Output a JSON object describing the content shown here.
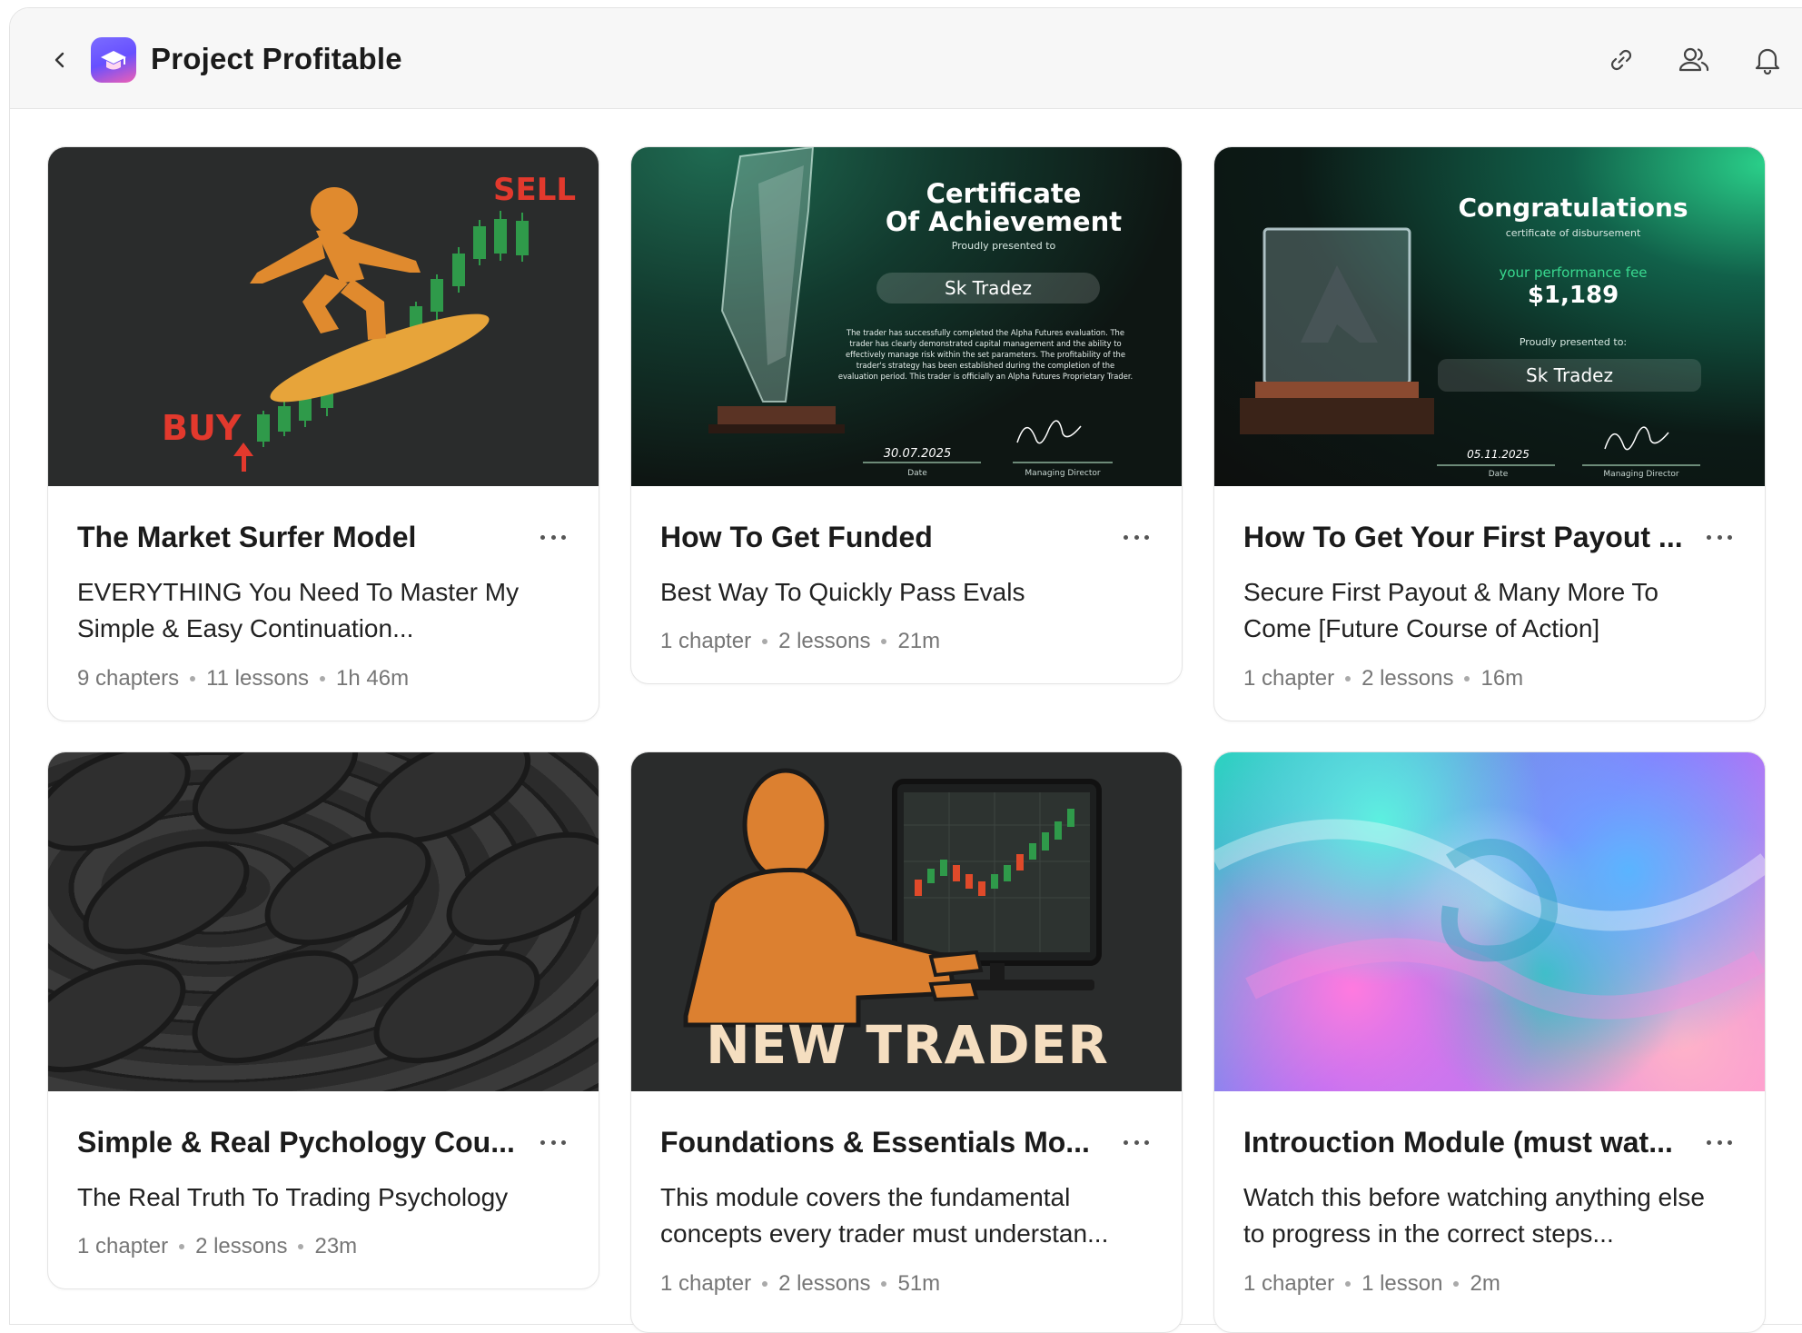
{
  "header": {
    "title": "Project Profitable",
    "back_icon": "chevron-left-icon",
    "logo_icon": "graduation-cap-icon",
    "actions": [
      "link-icon",
      "users-icon",
      "bell-icon"
    ]
  },
  "courses": [
    {
      "title": "The Market Surfer Model",
      "description": "EVERYTHING You Need To Master My Simple & Easy Continuation...",
      "chapters": "9 chapters",
      "lessons": "11 lessons",
      "duration": "1h 46m",
      "thumb": {
        "sell": "SELL",
        "buy": "BUY"
      }
    },
    {
      "title": "How To Get Funded",
      "description": "Best Way To Quickly Pass Evals",
      "chapters": "1 chapter",
      "lessons": "2 lessons",
      "duration": "21m",
      "thumb": {
        "heading1": "Certificate",
        "heading2": "Of Achievement",
        "presented": "Proudly presented to",
        "name": "Sk Tradez",
        "body": "The trader has successfully completed the Alpha Futures evaluation. The trader has clearly demonstrated capital management and the ability to effectively manage risk within the set parameters. The profitability of the trader's strategy has been established during the completion of the evaluation period. This trader is officially an Alpha Futures Proprietary Trader.",
        "date": "30.07.2025",
        "date_label": "Date",
        "sign_label": "Managing Director"
      }
    },
    {
      "title": "How To Get Your First Payout ...",
      "description": "Secure First Payout & Many More To Come [Future Course of Action]",
      "chapters": "1 chapter",
      "lessons": "2 lessons",
      "duration": "16m",
      "thumb": {
        "heading": "Congratulations",
        "sub": "certificate of disbursement",
        "fee_label": "your performance fee",
        "amount": "$1,189",
        "presented": "Proudly presented to:",
        "name": "Sk Tradez",
        "date": "05.11.2025",
        "date_label": "Date",
        "sign_label": "Managing Director"
      }
    },
    {
      "title": "Simple & Real Pychology Cou...",
      "description": "The Real Truth To Trading Psychology",
      "chapters": "1 chapter",
      "lessons": "2 lessons",
      "duration": "23m",
      "thumb": {}
    },
    {
      "title": "Foundations & Essentials Mo...",
      "description": "This module covers the fundamental concepts every trader must understan...",
      "chapters": "1 chapter",
      "lessons": "2 lessons",
      "duration": "51m",
      "thumb": {
        "banner": "NEW TRADER"
      }
    },
    {
      "title": "Introuction Module (must wat...",
      "description": "Watch this before watching anything else to progress in the correct steps...",
      "chapters": "1 chapter",
      "lessons": "1 lesson",
      "duration": "2m",
      "thumb": {}
    }
  ]
}
